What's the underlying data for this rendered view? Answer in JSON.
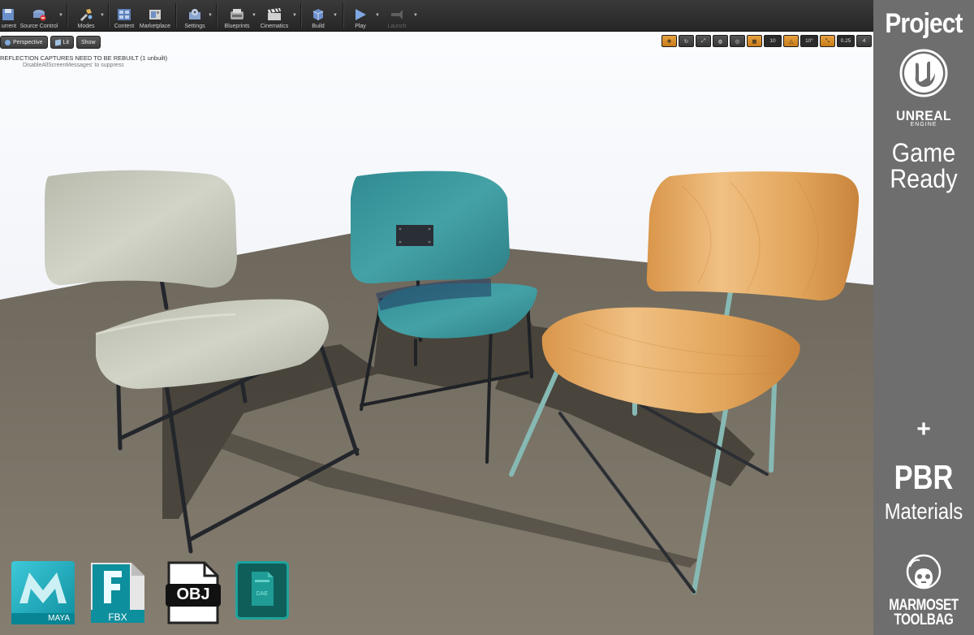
{
  "toolbar": {
    "items": [
      {
        "label": "urrent",
        "icon": "save-icon"
      },
      {
        "label": "Source Control",
        "icon": "source-control-icon"
      },
      {
        "label": "Modes",
        "icon": "modes-icon"
      },
      {
        "label": "Content",
        "icon": "content-browser-icon"
      },
      {
        "label": "Marketplace",
        "icon": "marketplace-icon"
      },
      {
        "label": "Settings",
        "icon": "settings-icon"
      },
      {
        "label": "Blueprints",
        "icon": "blueprints-icon"
      },
      {
        "label": "Cinematics",
        "icon": "cinematics-icon"
      },
      {
        "label": "Build",
        "icon": "build-icon"
      },
      {
        "label": "Play",
        "icon": "play-icon"
      },
      {
        "label": "Launch",
        "icon": "launch-icon"
      }
    ]
  },
  "viewport": {
    "perspective_label": "Perspective",
    "lit_label": "Lit",
    "show_label": "Show",
    "message": "REFLECTION CAPTURES NEED TO BE REBUILT (1 unbuilt)",
    "message_hint": "DisableAllScreenMessages' to suppress",
    "grid_snap": "10",
    "rotation_snap": "10°",
    "scale_snap": "0.25",
    "camera_speed": "4"
  },
  "badges": {
    "maya": "MAYA",
    "fbx": "FBX",
    "obj": "OBJ",
    "dae": "DAE"
  },
  "panel": {
    "project": "Project",
    "unreal": "UNREAL",
    "engine": "ENGINE",
    "game": "Game",
    "ready": "Ready",
    "plus": "+",
    "pbr": "PBR",
    "materials": "Materials",
    "marmoset": "MARMOSET",
    "toolbag": "TOOLBAG"
  },
  "colors": {
    "accent_orange": "#e8a040",
    "panel_gray": "#6e6e6e",
    "chair_gray": "#c8cabd",
    "chair_teal": "#3a9aa0",
    "chair_wood": "#e0a455",
    "floor": "#7d766a",
    "sky": "#f4f6fb"
  }
}
